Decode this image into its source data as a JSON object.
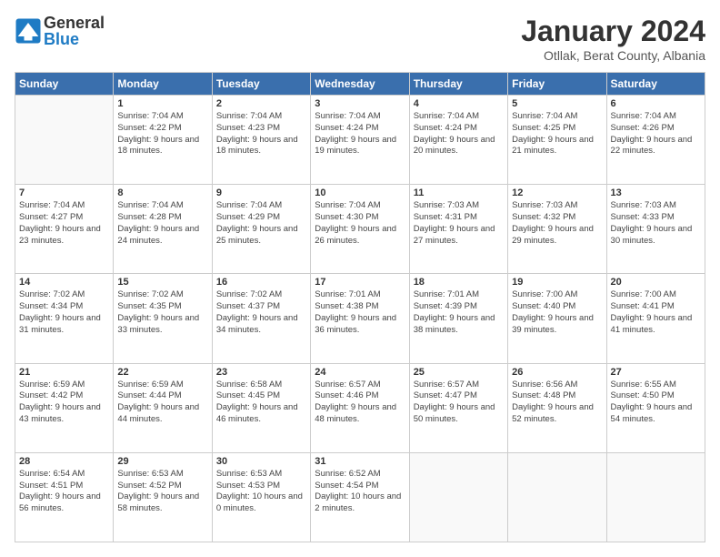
{
  "logo": {
    "general": "General",
    "blue": "Blue"
  },
  "title": "January 2024",
  "subtitle": "Otllak, Berat County, Albania",
  "days": [
    "Sunday",
    "Monday",
    "Tuesday",
    "Wednesday",
    "Thursday",
    "Friday",
    "Saturday"
  ],
  "weeks": [
    [
      {
        "day": "",
        "sunrise": "",
        "sunset": "",
        "daylight": ""
      },
      {
        "day": "1",
        "sunrise": "7:04 AM",
        "sunset": "4:22 PM",
        "daylight": "9 hours and 18 minutes."
      },
      {
        "day": "2",
        "sunrise": "7:04 AM",
        "sunset": "4:23 PM",
        "daylight": "9 hours and 18 minutes."
      },
      {
        "day": "3",
        "sunrise": "7:04 AM",
        "sunset": "4:24 PM",
        "daylight": "9 hours and 19 minutes."
      },
      {
        "day": "4",
        "sunrise": "7:04 AM",
        "sunset": "4:24 PM",
        "daylight": "9 hours and 20 minutes."
      },
      {
        "day": "5",
        "sunrise": "7:04 AM",
        "sunset": "4:25 PM",
        "daylight": "9 hours and 21 minutes."
      },
      {
        "day": "6",
        "sunrise": "7:04 AM",
        "sunset": "4:26 PM",
        "daylight": "9 hours and 22 minutes."
      }
    ],
    [
      {
        "day": "7",
        "sunrise": "7:04 AM",
        "sunset": "4:27 PM",
        "daylight": "9 hours and 23 minutes."
      },
      {
        "day": "8",
        "sunrise": "7:04 AM",
        "sunset": "4:28 PM",
        "daylight": "9 hours and 24 minutes."
      },
      {
        "day": "9",
        "sunrise": "7:04 AM",
        "sunset": "4:29 PM",
        "daylight": "9 hours and 25 minutes."
      },
      {
        "day": "10",
        "sunrise": "7:04 AM",
        "sunset": "4:30 PM",
        "daylight": "9 hours and 26 minutes."
      },
      {
        "day": "11",
        "sunrise": "7:03 AM",
        "sunset": "4:31 PM",
        "daylight": "9 hours and 27 minutes."
      },
      {
        "day": "12",
        "sunrise": "7:03 AM",
        "sunset": "4:32 PM",
        "daylight": "9 hours and 29 minutes."
      },
      {
        "day": "13",
        "sunrise": "7:03 AM",
        "sunset": "4:33 PM",
        "daylight": "9 hours and 30 minutes."
      }
    ],
    [
      {
        "day": "14",
        "sunrise": "7:02 AM",
        "sunset": "4:34 PM",
        "daylight": "9 hours and 31 minutes."
      },
      {
        "day": "15",
        "sunrise": "7:02 AM",
        "sunset": "4:35 PM",
        "daylight": "9 hours and 33 minutes."
      },
      {
        "day": "16",
        "sunrise": "7:02 AM",
        "sunset": "4:37 PM",
        "daylight": "9 hours and 34 minutes."
      },
      {
        "day": "17",
        "sunrise": "7:01 AM",
        "sunset": "4:38 PM",
        "daylight": "9 hours and 36 minutes."
      },
      {
        "day": "18",
        "sunrise": "7:01 AM",
        "sunset": "4:39 PM",
        "daylight": "9 hours and 38 minutes."
      },
      {
        "day": "19",
        "sunrise": "7:00 AM",
        "sunset": "4:40 PM",
        "daylight": "9 hours and 39 minutes."
      },
      {
        "day": "20",
        "sunrise": "7:00 AM",
        "sunset": "4:41 PM",
        "daylight": "9 hours and 41 minutes."
      }
    ],
    [
      {
        "day": "21",
        "sunrise": "6:59 AM",
        "sunset": "4:42 PM",
        "daylight": "9 hours and 43 minutes."
      },
      {
        "day": "22",
        "sunrise": "6:59 AM",
        "sunset": "4:44 PM",
        "daylight": "9 hours and 44 minutes."
      },
      {
        "day": "23",
        "sunrise": "6:58 AM",
        "sunset": "4:45 PM",
        "daylight": "9 hours and 46 minutes."
      },
      {
        "day": "24",
        "sunrise": "6:57 AM",
        "sunset": "4:46 PM",
        "daylight": "9 hours and 48 minutes."
      },
      {
        "day": "25",
        "sunrise": "6:57 AM",
        "sunset": "4:47 PM",
        "daylight": "9 hours and 50 minutes."
      },
      {
        "day": "26",
        "sunrise": "6:56 AM",
        "sunset": "4:48 PM",
        "daylight": "9 hours and 52 minutes."
      },
      {
        "day": "27",
        "sunrise": "6:55 AM",
        "sunset": "4:50 PM",
        "daylight": "9 hours and 54 minutes."
      }
    ],
    [
      {
        "day": "28",
        "sunrise": "6:54 AM",
        "sunset": "4:51 PM",
        "daylight": "9 hours and 56 minutes."
      },
      {
        "day": "29",
        "sunrise": "6:53 AM",
        "sunset": "4:52 PM",
        "daylight": "9 hours and 58 minutes."
      },
      {
        "day": "30",
        "sunrise": "6:53 AM",
        "sunset": "4:53 PM",
        "daylight": "10 hours and 0 minutes."
      },
      {
        "day": "31",
        "sunrise": "6:52 AM",
        "sunset": "4:54 PM",
        "daylight": "10 hours and 2 minutes."
      },
      {
        "day": "",
        "sunrise": "",
        "sunset": "",
        "daylight": ""
      },
      {
        "day": "",
        "sunrise": "",
        "sunset": "",
        "daylight": ""
      },
      {
        "day": "",
        "sunrise": "",
        "sunset": "",
        "daylight": ""
      }
    ]
  ],
  "labels": {
    "sunrise_prefix": "Sunrise: ",
    "sunset_prefix": "Sunset: ",
    "daylight_prefix": "Daylight: "
  }
}
